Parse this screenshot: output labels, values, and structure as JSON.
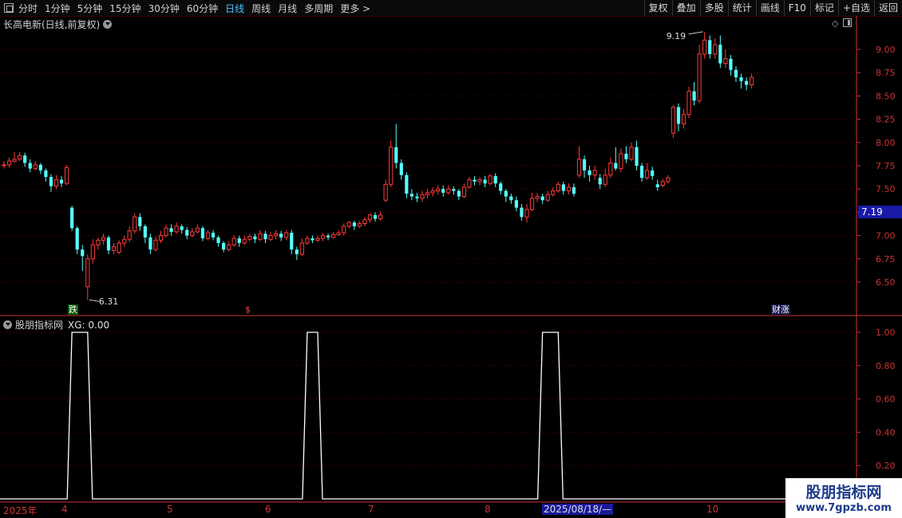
{
  "toolbar": {
    "periods": [
      "分时",
      "1分钟",
      "5分钟",
      "15分钟",
      "30分钟",
      "60分钟",
      "日线",
      "周线",
      "月线",
      "多周期",
      "更多 >"
    ],
    "active_period": "日线",
    "buttons": [
      "复权",
      "叠加",
      "多股",
      "统计",
      "画线",
      "F10",
      "标记",
      "+自选",
      "返回"
    ]
  },
  "chart_title": "长高电新(日线,前复权)",
  "indicator": {
    "name": "股朋指标网",
    "xg_label": "XG: 0.00"
  },
  "current_price_label": "7.19",
  "annotations": {
    "high_label": "9.19",
    "low_label": "6.31",
    "tag_die": "跌",
    "tag_dollar": "$",
    "tag_caizhang": "财涨"
  },
  "dates": {
    "year": "2025年",
    "m4": "4",
    "m5": "5",
    "m6": "6",
    "m7": "7",
    "m8": "8",
    "highlight": "2025/08/18/—",
    "m10": "10"
  },
  "watermark": {
    "line1": "股朋指标网",
    "line2": "www.7gpzb.com"
  },
  "colors": {
    "up": "#ff3b3b",
    "down": "#54ffff",
    "grid": "#5a0000",
    "axis": "#cc3333",
    "signal": "#ffffff"
  },
  "chart_data": [
    {
      "type": "candlestick",
      "title": "长高电新(日线,前复权)",
      "y_ticks": [
        6.5,
        6.75,
        7.0,
        7.25,
        7.5,
        7.75,
        8.0,
        8.25,
        8.5,
        8.75,
        9.0
      ],
      "ylim": [
        6.28,
        9.3
      ],
      "grid": true,
      "candles": [
        [
          7.76,
          7.76,
          7.8,
          7.72
        ],
        [
          7.76,
          7.8,
          7.84,
          7.73
        ],
        [
          7.8,
          7.82,
          7.9,
          7.78
        ],
        [
          7.82,
          7.86,
          7.9,
          7.8
        ],
        [
          7.86,
          7.78,
          7.89,
          7.74
        ],
        [
          7.78,
          7.72,
          7.82,
          7.68
        ],
        [
          7.72,
          7.76,
          7.8,
          7.7
        ],
        [
          7.76,
          7.7,
          7.78,
          7.66
        ],
        [
          7.7,
          7.63,
          7.72,
          7.58
        ],
        [
          7.63,
          7.53,
          7.66,
          7.47
        ],
        [
          7.53,
          7.6,
          7.65,
          7.5
        ],
        [
          7.6,
          7.56,
          7.64,
          7.52
        ],
        [
          7.56,
          7.73,
          7.76,
          7.54
        ],
        [
          7.3,
          7.08,
          7.32,
          7.05
        ],
        [
          7.08,
          6.85,
          7.1,
          6.8
        ],
        [
          6.85,
          6.78,
          6.9,
          6.62
        ],
        [
          6.45,
          6.75,
          6.8,
          6.31
        ],
        [
          6.75,
          6.9,
          6.96,
          6.7
        ],
        [
          6.9,
          6.95,
          6.98,
          6.85
        ],
        [
          6.95,
          6.98,
          7.02,
          6.9
        ],
        [
          6.98,
          6.84,
          7.0,
          6.8
        ],
        [
          6.84,
          6.88,
          6.92,
          6.8
        ],
        [
          6.82,
          6.92,
          6.95,
          6.8
        ],
        [
          6.92,
          6.96,
          7.0,
          6.88
        ],
        [
          6.96,
          7.05,
          7.1,
          6.93
        ],
        [
          7.05,
          7.2,
          7.24,
          7.02
        ],
        [
          7.2,
          7.1,
          7.24,
          7.05
        ],
        [
          7.1,
          6.98,
          7.12,
          6.92
        ],
        [
          6.98,
          6.85,
          7.02,
          6.8
        ],
        [
          6.85,
          6.95,
          6.99,
          6.83
        ],
        [
          6.95,
          7.0,
          7.05,
          6.92
        ],
        [
          7.0,
          7.08,
          7.12,
          6.98
        ],
        [
          7.08,
          7.04,
          7.12,
          7.0
        ],
        [
          7.04,
          7.1,
          7.14,
          7.02
        ],
        [
          7.1,
          7.06,
          7.12,
          7.02
        ],
        [
          7.06,
          7.0,
          7.09,
          6.96
        ],
        [
          7.0,
          7.04,
          7.08,
          6.98
        ],
        [
          7.04,
          7.08,
          7.12,
          7.02
        ],
        [
          7.08,
          6.97,
          7.1,
          6.94
        ],
        [
          6.97,
          7.03,
          7.06,
          6.95
        ],
        [
          7.03,
          6.98,
          7.06,
          6.95
        ],
        [
          6.98,
          6.92,
          7.0,
          6.88
        ],
        [
          6.92,
          6.85,
          6.94,
          6.82
        ],
        [
          6.85,
          6.9,
          6.94,
          6.83
        ],
        [
          6.9,
          6.97,
          7.0,
          6.88
        ],
        [
          6.97,
          6.92,
          7.0,
          6.88
        ],
        [
          6.92,
          6.96,
          7.0,
          6.9
        ],
        [
          6.96,
          6.99,
          7.02,
          6.94
        ],
        [
          6.99,
          6.96,
          7.02,
          6.92
        ],
        [
          6.96,
          7.02,
          7.06,
          6.94
        ],
        [
          7.02,
          6.96,
          7.05,
          6.92
        ],
        [
          6.96,
          7.0,
          7.04,
          6.94
        ],
        [
          7.0,
          7.02,
          7.06,
          6.96
        ],
        [
          7.02,
          6.98,
          7.05,
          6.94
        ],
        [
          6.98,
          7.03,
          7.06,
          6.95
        ],
        [
          7.03,
          6.85,
          7.06,
          6.8
        ],
        [
          6.85,
          6.8,
          6.88,
          6.74
        ],
        [
          6.8,
          6.92,
          6.97,
          6.78
        ],
        [
          6.92,
          6.97,
          7.0,
          6.9
        ],
        [
          6.97,
          6.95,
          7.0,
          6.92
        ],
        [
          6.95,
          6.97,
          7.0,
          6.93
        ],
        [
          6.97,
          7.0,
          7.03,
          6.94
        ],
        [
          7.0,
          6.98,
          7.02,
          6.95
        ],
        [
          6.98,
          7.01,
          7.04,
          6.97
        ],
        [
          7.01,
          7.03,
          7.06,
          7.0
        ],
        [
          7.03,
          7.1,
          7.13,
          7.0
        ],
        [
          7.1,
          7.14,
          7.16,
          7.08
        ],
        [
          7.14,
          7.1,
          7.16,
          7.06
        ],
        [
          7.1,
          7.13,
          7.16,
          7.08
        ],
        [
          7.13,
          7.17,
          7.2,
          7.1
        ],
        [
          7.17,
          7.22,
          7.24,
          7.14
        ],
        [
          7.22,
          7.18,
          7.25,
          7.15
        ],
        [
          7.18,
          7.22,
          7.26,
          7.16
        ],
        [
          7.38,
          7.55,
          7.6,
          7.36
        ],
        [
          7.55,
          7.95,
          8.02,
          7.52
        ],
        [
          7.95,
          7.78,
          8.2,
          7.72
        ],
        [
          7.78,
          7.65,
          7.82,
          7.6
        ],
        [
          7.65,
          7.45,
          7.68,
          7.4
        ],
        [
          7.45,
          7.42,
          7.5,
          7.38
        ],
        [
          7.42,
          7.4,
          7.46,
          7.36
        ],
        [
          7.4,
          7.44,
          7.48,
          7.36
        ],
        [
          7.44,
          7.46,
          7.5,
          7.4
        ],
        [
          7.46,
          7.48,
          7.52,
          7.42
        ],
        [
          7.48,
          7.5,
          7.54,
          7.44
        ],
        [
          7.5,
          7.46,
          7.54,
          7.42
        ],
        [
          7.46,
          7.5,
          7.54,
          7.44
        ],
        [
          7.5,
          7.48,
          7.53,
          7.44
        ],
        [
          7.48,
          7.42,
          7.5,
          7.38
        ],
        [
          7.42,
          7.52,
          7.56,
          7.4
        ],
        [
          7.52,
          7.6,
          7.63,
          7.5
        ],
        [
          7.6,
          7.58,
          7.64,
          7.54
        ],
        [
          7.58,
          7.6,
          7.63,
          7.54
        ],
        [
          7.6,
          7.56,
          7.64,
          7.52
        ],
        [
          7.56,
          7.64,
          7.66,
          7.54
        ],
        [
          7.64,
          7.56,
          7.67,
          7.52
        ],
        [
          7.56,
          7.48,
          7.58,
          7.44
        ],
        [
          7.48,
          7.42,
          7.5,
          7.36
        ],
        [
          7.42,
          7.38,
          7.45,
          7.34
        ],
        [
          7.38,
          7.3,
          7.42,
          7.26
        ],
        [
          7.3,
          7.2,
          7.34,
          7.16
        ],
        [
          7.2,
          7.28,
          7.34,
          7.14
        ],
        [
          7.28,
          7.4,
          7.46,
          7.26
        ],
        [
          7.4,
          7.42,
          7.46,
          7.36
        ],
        [
          7.42,
          7.38,
          7.45,
          7.34
        ],
        [
          7.38,
          7.44,
          7.48,
          7.36
        ],
        [
          7.44,
          7.48,
          7.52,
          7.42
        ],
        [
          7.48,
          7.55,
          7.58,
          7.46
        ],
        [
          7.55,
          7.48,
          7.58,
          7.44
        ],
        [
          7.48,
          7.52,
          7.56,
          7.44
        ],
        [
          7.52,
          7.45,
          7.56,
          7.42
        ],
        [
          7.65,
          7.82,
          7.96,
          7.62
        ],
        [
          7.82,
          7.7,
          7.86,
          7.62
        ],
        [
          7.7,
          7.65,
          7.75,
          7.58
        ],
        [
          7.65,
          7.7,
          7.75,
          7.6
        ],
        [
          7.62,
          7.55,
          7.66,
          7.5
        ],
        [
          7.55,
          7.65,
          7.72,
          7.52
        ],
        [
          7.65,
          7.78,
          7.84,
          7.62
        ],
        [
          7.78,
          7.72,
          7.95,
          7.7
        ],
        [
          7.72,
          7.88,
          7.94,
          7.68
        ],
        [
          7.88,
          7.82,
          7.96,
          7.78
        ],
        [
          7.82,
          7.95,
          8.0,
          7.8
        ],
        [
          7.95,
          7.75,
          8.02,
          7.7
        ],
        [
          7.75,
          7.62,
          7.78,
          7.58
        ],
        [
          7.62,
          7.7,
          7.78,
          7.6
        ],
        [
          7.7,
          7.64,
          7.74,
          7.6
        ],
        [
          7.55,
          7.52,
          7.6,
          7.48
        ],
        [
          7.54,
          7.58,
          7.61,
          7.52
        ],
        [
          7.58,
          7.62,
          7.65,
          7.56
        ],
        [
          8.1,
          8.38,
          8.4,
          8.05
        ],
        [
          8.38,
          8.2,
          8.42,
          8.12
        ],
        [
          8.2,
          8.3,
          8.36,
          8.15
        ],
        [
          8.3,
          8.55,
          8.6,
          8.26
        ],
        [
          8.55,
          8.45,
          8.65,
          8.4
        ],
        [
          8.45,
          8.95,
          9.05,
          8.42
        ],
        [
          8.95,
          9.1,
          9.19,
          8.9
        ],
        [
          9.1,
          8.95,
          9.15,
          8.9
        ],
        [
          8.95,
          9.05,
          9.12,
          8.9
        ],
        [
          9.05,
          8.85,
          9.15,
          8.8
        ],
        [
          8.85,
          8.9,
          9.0,
          8.8
        ],
        [
          8.9,
          8.78,
          8.94,
          8.72
        ],
        [
          8.78,
          8.7,
          8.82,
          8.65
        ],
        [
          8.7,
          8.66,
          8.74,
          8.58
        ],
        [
          8.66,
          8.62,
          8.7,
          8.56
        ],
        [
          8.62,
          8.7,
          8.74,
          8.58
        ]
      ]
    },
    {
      "type": "line",
      "name": "股朋指标网",
      "y_ticks": [
        0.2,
        0.4,
        0.6,
        0.8,
        1.0
      ],
      "ylim": [
        0,
        1.05
      ],
      "pulses": [
        [
          13,
          16
        ],
        [
          58,
          60
        ],
        [
          103,
          106
        ]
      ]
    }
  ]
}
